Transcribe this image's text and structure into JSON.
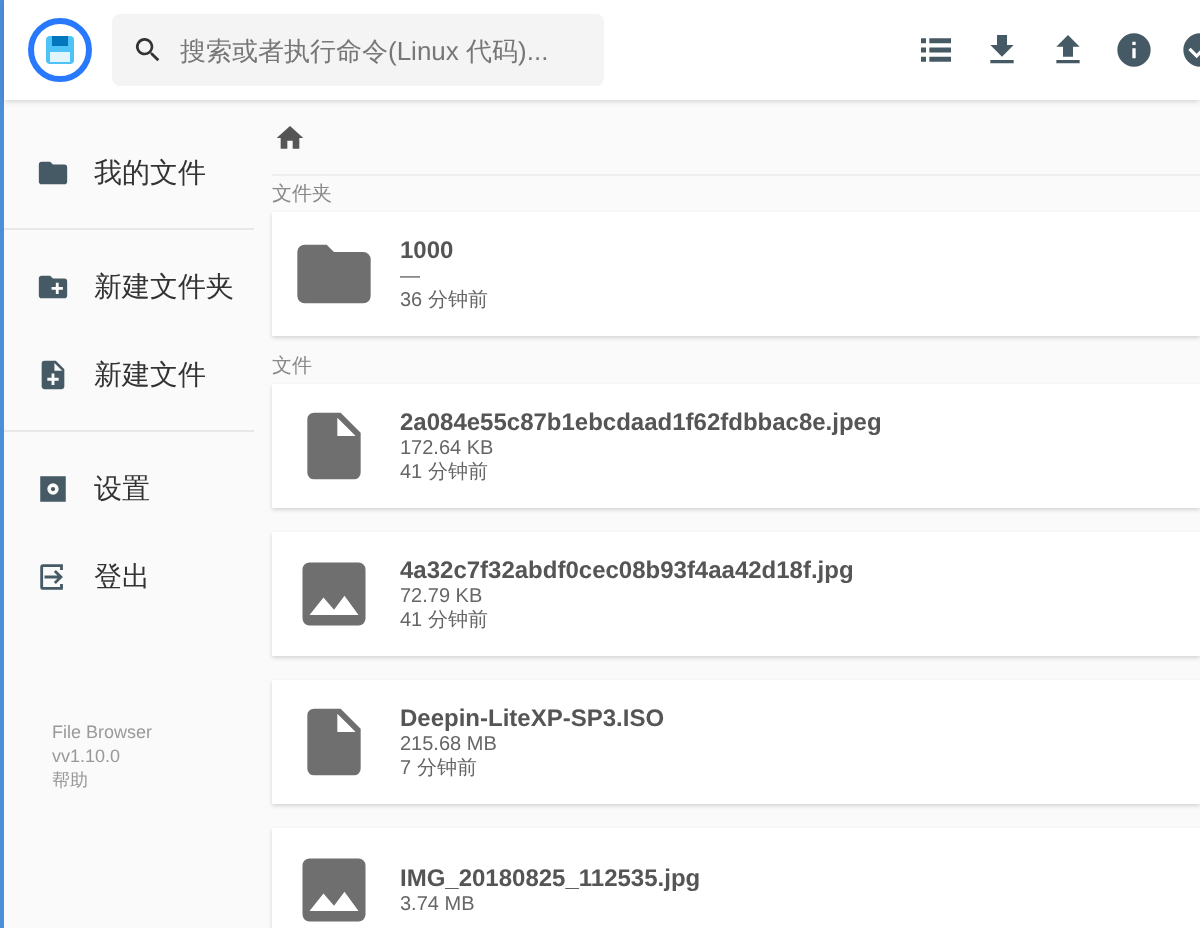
{
  "header": {
    "search": {
      "placeholder": "搜索或者执行命令(Linux 代码)..."
    },
    "actions": [
      {
        "kind": "list"
      },
      {
        "kind": "download"
      },
      {
        "kind": "upload"
      },
      {
        "kind": "info"
      },
      {
        "kind": "check"
      }
    ]
  },
  "sidebar": {
    "groups": [
      [
        {
          "kind": "folder",
          "label": "我的文件"
        }
      ],
      [
        {
          "kind": "new-folder",
          "label": "新建文件夹"
        },
        {
          "kind": "new-file",
          "label": "新建文件"
        }
      ],
      [
        {
          "kind": "settings",
          "label": "设置"
        },
        {
          "kind": "logout",
          "label": "登出"
        }
      ]
    ],
    "footer": [
      "File Browser",
      "vv1.10.0",
      "帮助"
    ]
  },
  "sections": [
    {
      "title": "文件夹",
      "items": [
        {
          "kind": "folder",
          "name": "1000",
          "size": "—",
          "modified": "36 分钟前"
        }
      ]
    },
    {
      "title": "文件",
      "items": [
        {
          "kind": "file",
          "name": "2a084e55c87b1ebcdaad1f62fdbbac8e.jpeg",
          "size": "172.64 KB",
          "modified": "41 分钟前"
        },
        {
          "kind": "image",
          "name": "4a32c7f32abdf0cec08b93f4aa42d18f.jpg",
          "size": "72.79 KB",
          "modified": "41 分钟前"
        },
        {
          "kind": "file",
          "name": "Deepin-LiteXP-SP3.ISO",
          "size": "215.68 MB",
          "modified": "7 分钟前"
        },
        {
          "kind": "image",
          "name": "IMG_20180825_112535.jpg",
          "size": "3.74 MB"
        }
      ]
    }
  ]
}
